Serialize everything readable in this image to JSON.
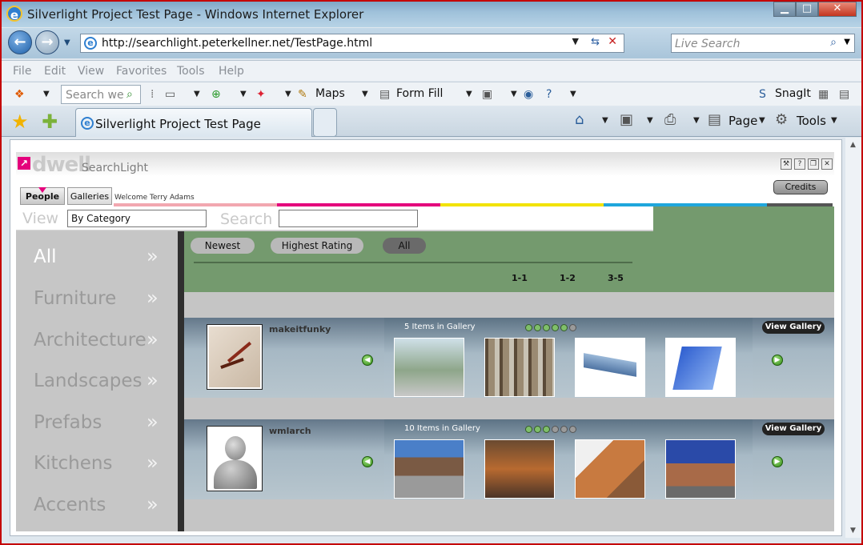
{
  "browser": {
    "title": "Silverlight Project Test Page - Windows Internet Explorer",
    "url": "http://searchlight.peterkellner.net/TestPage.html",
    "search_placeholder": "Live Search",
    "menu": [
      "File",
      "Edit",
      "View",
      "Favorites",
      "Tools",
      "Help"
    ],
    "links_search_placeholder": "Search we",
    "links": {
      "maps": "Maps",
      "formfill": "Form Fill",
      "snagit": "SnagIt"
    },
    "tab_title": "Silverlight Project Test Page",
    "cmd": {
      "page": "Page",
      "tools": "Tools"
    }
  },
  "app": {
    "logo": "dwell",
    "logo_sub": "SearchLight",
    "tab_people": "People",
    "tab_galleries": "Galleries",
    "welcome": "Welcome Terry Adams",
    "credits": "Credits",
    "view_label": "View",
    "view_value": "By Category",
    "search_label": "Search",
    "search_value": "",
    "colors": [
      "#f2a7b0",
      "#e4007c",
      "#f2e300",
      "#1fa6dc",
      "#555555"
    ],
    "categories": [
      "All",
      "Furniture",
      "Architecture",
      "Landscapes",
      "Prefabs",
      "Kitchens",
      "Accents"
    ],
    "arrow": "»",
    "filters": [
      "Newest",
      "Highest Rating",
      "All"
    ],
    "ranges": [
      "1-1",
      "1-2",
      "3-5"
    ],
    "users": [
      {
        "name": "makeitfunky",
        "items": "5 Items in Gallery",
        "dots_on": 5,
        "dots_total": 6,
        "view": "View Gallery"
      },
      {
        "name": "wmlarch",
        "items": "10 Items in Gallery",
        "dots_on": 3,
        "dots_total": 6,
        "view": "View Gallery"
      }
    ]
  }
}
